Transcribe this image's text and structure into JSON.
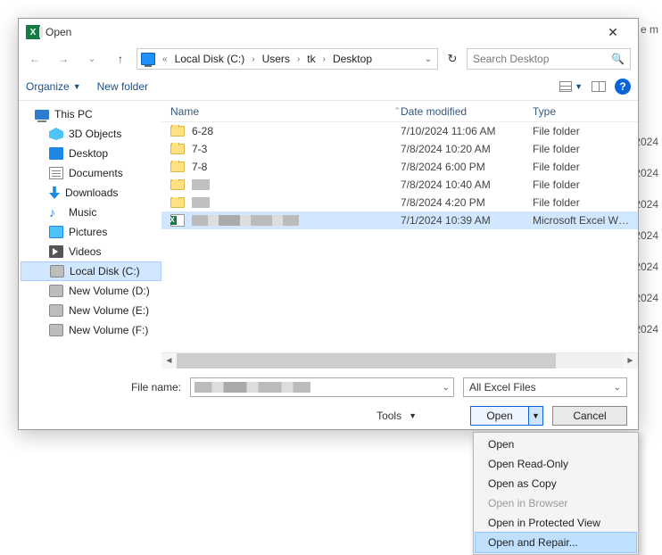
{
  "dialog": {
    "title": "Open",
    "close_glyph": "✕"
  },
  "addressbar": {
    "prefix": "«",
    "crumbs": [
      "Local Disk (C:)",
      "Users",
      "tk",
      "Desktop"
    ],
    "refresh_glyph": "↻",
    "dropdown_glyph": "⌄"
  },
  "search": {
    "placeholder": "Search Desktop",
    "icon_glyph": "🔍"
  },
  "toolbar": {
    "organize": "Organize",
    "new_folder": "New folder",
    "help_glyph": "?"
  },
  "nav": {
    "this_pc": "This PC",
    "items": [
      {
        "label": "3D Objects",
        "icon": "3d"
      },
      {
        "label": "Desktop",
        "icon": "desk"
      },
      {
        "label": "Documents",
        "icon": "doc"
      },
      {
        "label": "Downloads",
        "icon": "dl"
      },
      {
        "label": "Music",
        "icon": "music"
      },
      {
        "label": "Pictures",
        "icon": "pic"
      },
      {
        "label": "Videos",
        "icon": "vid"
      },
      {
        "label": "Local Disk (C:)",
        "icon": "disk",
        "selected": true
      },
      {
        "label": "New Volume (D:)",
        "icon": "disk"
      },
      {
        "label": "New Volume (E:)",
        "icon": "disk"
      },
      {
        "label": "New Volume (F:)",
        "icon": "disk"
      }
    ]
  },
  "columns": {
    "name": "Name",
    "date": "Date modified",
    "type": "Type"
  },
  "files": [
    {
      "name": "6-28",
      "date": "7/10/2024 11:06 AM",
      "type": "File folder",
      "kind": "folder"
    },
    {
      "name": "7-3",
      "date": "7/8/2024 10:20 AM",
      "type": "File folder",
      "kind": "folder"
    },
    {
      "name": "7-8",
      "date": "7/8/2024 6:00 PM",
      "type": "File folder",
      "kind": "folder"
    },
    {
      "name": "",
      "date": "7/8/2024 10:40 AM",
      "type": "File folder",
      "kind": "folder",
      "redacted": "short"
    },
    {
      "name": "",
      "date": "7/8/2024 4:20 PM",
      "type": "File folder",
      "kind": "folder",
      "redacted": "short"
    },
    {
      "name": "",
      "date": "7/1/2024 10:39 AM",
      "type": "Microsoft Excel W…",
      "kind": "xlsx",
      "redacted": "long",
      "selected": true
    }
  ],
  "filename": {
    "label": "File name:",
    "value_redacted": true
  },
  "file_type_filter": "All Excel Files",
  "tools_label": "Tools",
  "buttons": {
    "open": "Open",
    "cancel": "Cancel"
  },
  "open_menu": [
    {
      "label": "Open"
    },
    {
      "label": "Open Read-Only"
    },
    {
      "label": "Open as Copy"
    },
    {
      "label": "Open in Browser",
      "disabled": true
    },
    {
      "label": "Open in Protected View"
    },
    {
      "label": "Open and Repair...",
      "highlighted": true
    }
  ],
  "background_years": [
    "2024",
    "2024",
    "2024",
    "2024",
    "2024",
    "2024",
    "2024"
  ],
  "background_right_label": "e m"
}
